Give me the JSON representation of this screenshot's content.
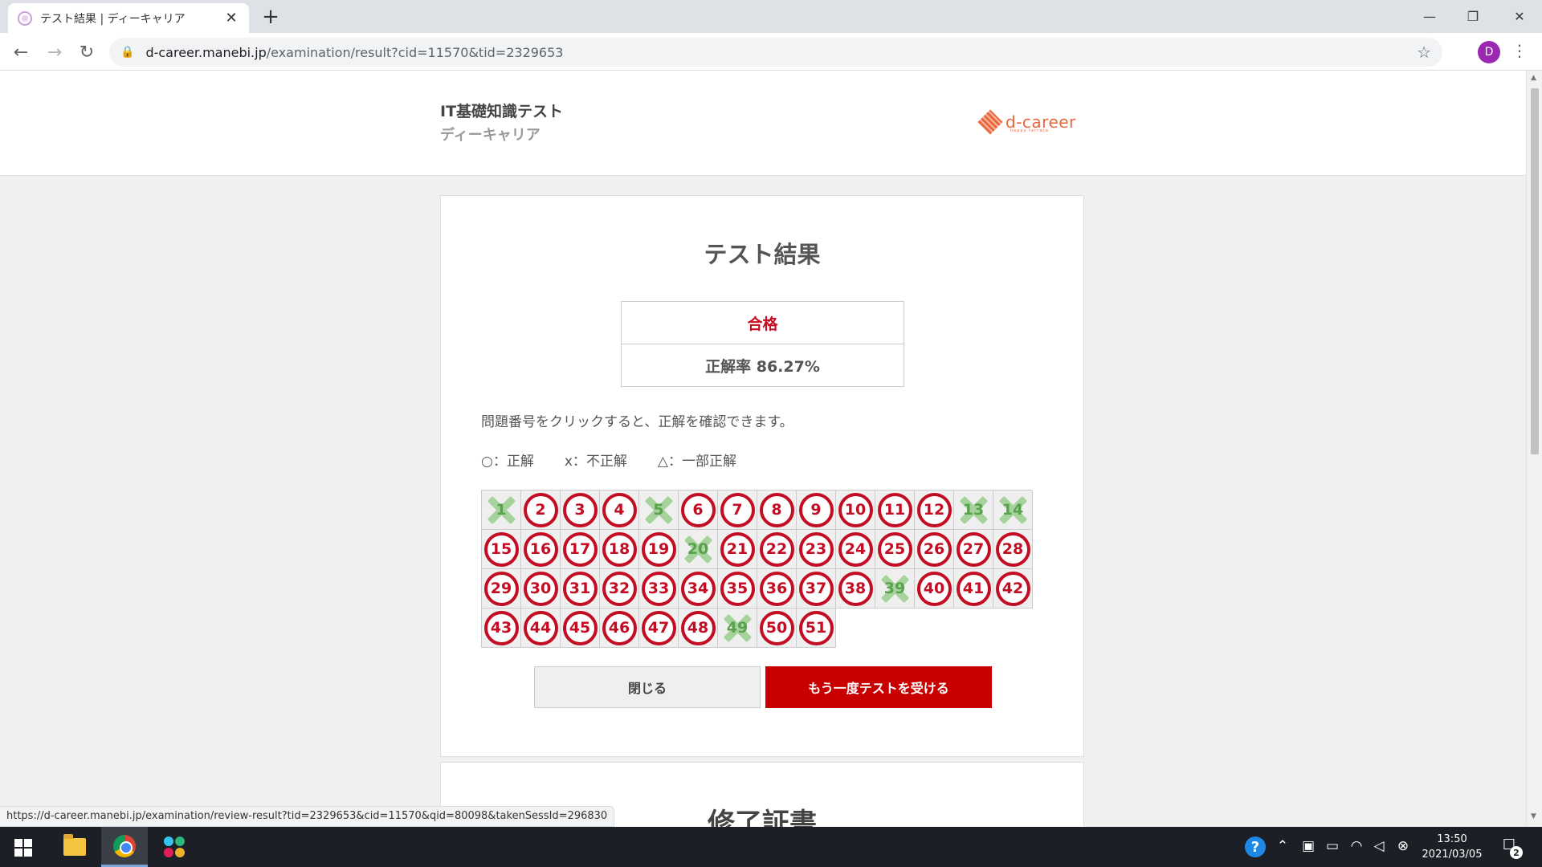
{
  "browser": {
    "tab_title": "テスト結果 | ディーキャリア",
    "tab_close": "✕",
    "new_tab": "+",
    "url_host": "d-career.manebi.jp",
    "url_path": "/examination/result?cid=11570&tid=2329653",
    "profile_initial": "D",
    "status_url": "https://d-career.manebi.jp/examination/review-result?tid=2329653&cid=11570&qid=80098&takenSessId=296830"
  },
  "header": {
    "title": "IT基礎知識テスト",
    "subtitle": "ディーキャリア",
    "logo_text": "d-career",
    "logo_tagline": "happy terrace"
  },
  "result": {
    "title": "テスト結果",
    "status": "合格",
    "rate": "正解率 86.27%",
    "hint": "問題番号をクリックすると、正解を確認できます。",
    "legend": [
      "○：正解",
      "x：不正解",
      "△：一部正解"
    ],
    "questions": [
      {
        "n": "1",
        "s": "wrong"
      },
      {
        "n": "2",
        "s": "correct"
      },
      {
        "n": "3",
        "s": "correct"
      },
      {
        "n": "4",
        "s": "correct"
      },
      {
        "n": "5",
        "s": "wrong"
      },
      {
        "n": "6",
        "s": "correct"
      },
      {
        "n": "7",
        "s": "correct"
      },
      {
        "n": "8",
        "s": "correct"
      },
      {
        "n": "9",
        "s": "correct"
      },
      {
        "n": "10",
        "s": "correct"
      },
      {
        "n": "11",
        "s": "correct"
      },
      {
        "n": "12",
        "s": "correct"
      },
      {
        "n": "13",
        "s": "wrong"
      },
      {
        "n": "14",
        "s": "wrong"
      },
      {
        "n": "15",
        "s": "correct"
      },
      {
        "n": "16",
        "s": "correct"
      },
      {
        "n": "17",
        "s": "correct"
      },
      {
        "n": "18",
        "s": "correct"
      },
      {
        "n": "19",
        "s": "correct"
      },
      {
        "n": "20",
        "s": "wrong"
      },
      {
        "n": "21",
        "s": "correct"
      },
      {
        "n": "22",
        "s": "correct"
      },
      {
        "n": "23",
        "s": "correct"
      },
      {
        "n": "24",
        "s": "correct"
      },
      {
        "n": "25",
        "s": "correct"
      },
      {
        "n": "26",
        "s": "correct"
      },
      {
        "n": "27",
        "s": "correct"
      },
      {
        "n": "28",
        "s": "correct"
      },
      {
        "n": "29",
        "s": "correct"
      },
      {
        "n": "30",
        "s": "correct"
      },
      {
        "n": "31",
        "s": "correct"
      },
      {
        "n": "32",
        "s": "correct"
      },
      {
        "n": "33",
        "s": "correct"
      },
      {
        "n": "34",
        "s": "correct"
      },
      {
        "n": "35",
        "s": "correct"
      },
      {
        "n": "36",
        "s": "correct"
      },
      {
        "n": "37",
        "s": "correct"
      },
      {
        "n": "38",
        "s": "correct"
      },
      {
        "n": "39",
        "s": "wrong"
      },
      {
        "n": "40",
        "s": "correct"
      },
      {
        "n": "41",
        "s": "correct"
      },
      {
        "n": "42",
        "s": "correct"
      },
      {
        "n": "43",
        "s": "correct"
      },
      {
        "n": "44",
        "s": "correct"
      },
      {
        "n": "45",
        "s": "correct"
      },
      {
        "n": "46",
        "s": "correct"
      },
      {
        "n": "47",
        "s": "correct"
      },
      {
        "n": "48",
        "s": "correct"
      },
      {
        "n": "49",
        "s": "wrong"
      },
      {
        "n": "50",
        "s": "correct"
      },
      {
        "n": "51",
        "s": "correct"
      }
    ],
    "close_button": "閉じる",
    "retake_button": "もう一度テストを受ける"
  },
  "next_section_title": "修了証書",
  "taskbar": {
    "time": "13:50",
    "date": "2021/03/05",
    "notification_count": "2"
  },
  "colors": {
    "accent_red": "#c30d23",
    "button_red": "#c80000",
    "wrong_green": "#a6d39b",
    "logo_orange": "#e8663c"
  }
}
